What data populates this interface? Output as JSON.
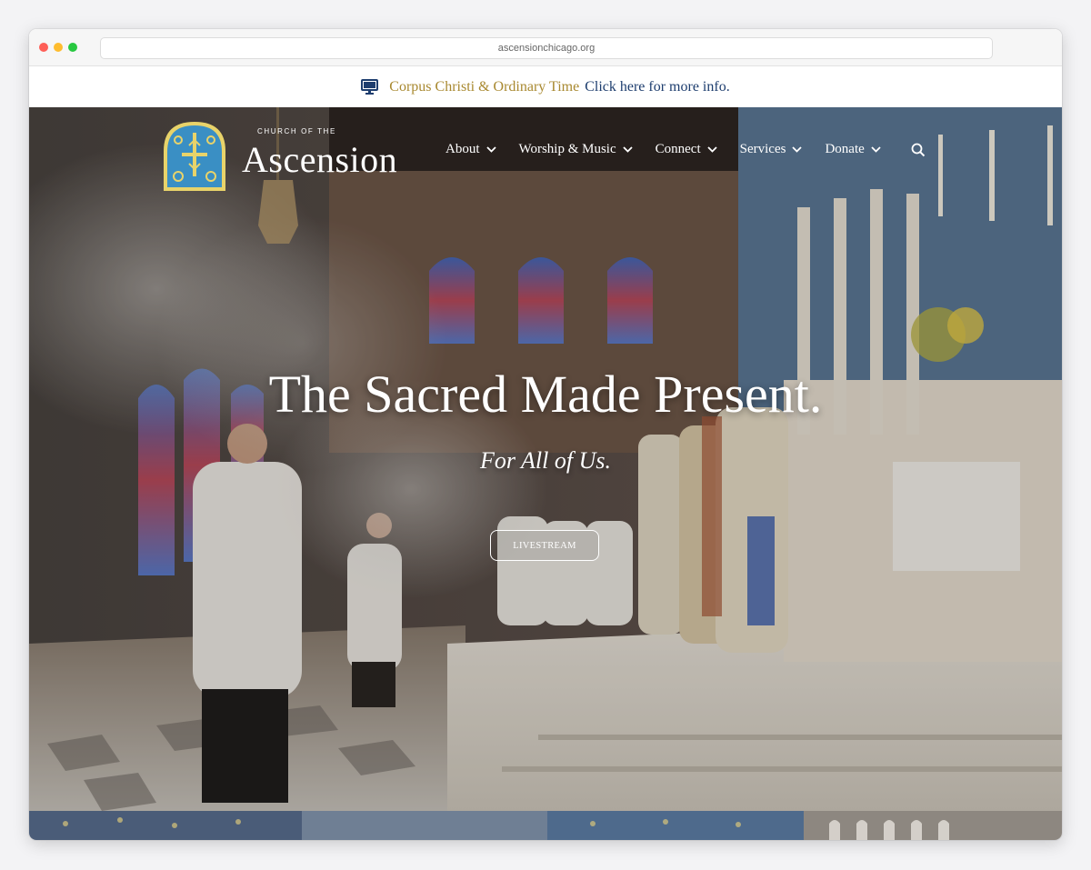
{
  "browser": {
    "url": "ascensionchicago.org"
  },
  "announcement": {
    "icon": "monitor-icon",
    "highlight": "Corpus Christi & Ordinary Time",
    "link": "Click here for more info.",
    "highlight_color": "#a8882f",
    "link_color": "#1d3d6e"
  },
  "logo": {
    "small_text": "CHURCH OF THE",
    "name": "Ascension"
  },
  "nav": {
    "items": [
      {
        "label": "About"
      },
      {
        "label": "Worship & Music"
      },
      {
        "label": "Connect"
      },
      {
        "label": "Services"
      },
      {
        "label": "Donate"
      }
    ],
    "search_icon": "search-icon"
  },
  "hero": {
    "headline": "The Sacred Made Present.",
    "subline": "For All of Us.",
    "cta": "LIVESTREAM"
  }
}
